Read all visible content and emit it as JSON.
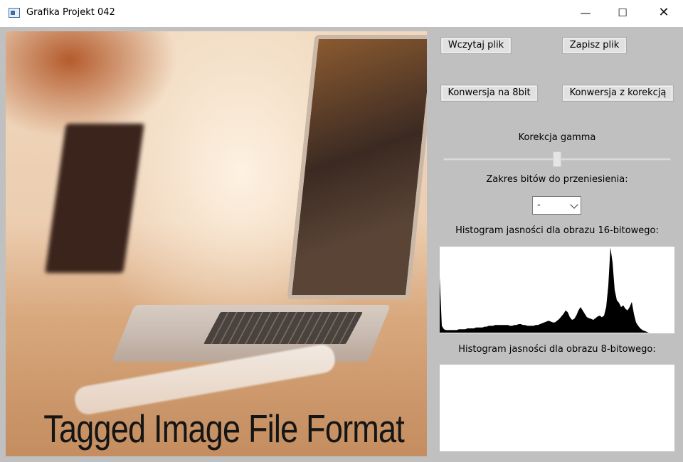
{
  "window": {
    "title": "Grafika Projekt 042",
    "controls": {
      "minimize": "—",
      "maximize": "☐",
      "close": "✕"
    }
  },
  "image": {
    "caption": "Tagged Image File Format"
  },
  "buttons": {
    "load": "Wczytaj plik",
    "save": "Zapisz plik",
    "convert_8bit": "Konwersja na 8bit",
    "convert_correction": "Konwersja z korekcją"
  },
  "gamma": {
    "label": "Korekcja gamma",
    "value_fraction": 0.5
  },
  "bits": {
    "label": "Zakres bitów do przeniesienia:",
    "selected": "-"
  },
  "histograms": {
    "hist16_label": "Histogram jasności dla obrazu 16-bitowego:",
    "hist8_label": "Histogram jasności dla obrazu 8-bitowego:",
    "hist16_color": "#000000",
    "hist16_levels": [
      0.65,
      0.08,
      0.04,
      0.03,
      0.03,
      0.03,
      0.03,
      0.03,
      0.03,
      0.04,
      0.04,
      0.04,
      0.04,
      0.05,
      0.05,
      0.05,
      0.05,
      0.06,
      0.06,
      0.06,
      0.06,
      0.07,
      0.07,
      0.08,
      0.08,
      0.08,
      0.09,
      0.09,
      0.09,
      0.09,
      0.09,
      0.09,
      0.09,
      0.08,
      0.08,
      0.09,
      0.09,
      0.1,
      0.1,
      0.09,
      0.09,
      0.08,
      0.08,
      0.08,
      0.08,
      0.09,
      0.09,
      0.1,
      0.11,
      0.12,
      0.13,
      0.14,
      0.13,
      0.12,
      0.12,
      0.14,
      0.16,
      0.19,
      0.22,
      0.26,
      0.24,
      0.18,
      0.15,
      0.16,
      0.2,
      0.26,
      0.3,
      0.26,
      0.22,
      0.18,
      0.17,
      0.16,
      0.15,
      0.17,
      0.19,
      0.2,
      0.18,
      0.2,
      0.3,
      0.55,
      1.0,
      0.82,
      0.5,
      0.38,
      0.35,
      0.3,
      0.32,
      0.28,
      0.26,
      0.3,
      0.36,
      0.22,
      0.12,
      0.08,
      0.05,
      0.03,
      0.02,
      0.01,
      0.0,
      0.0
    ]
  }
}
